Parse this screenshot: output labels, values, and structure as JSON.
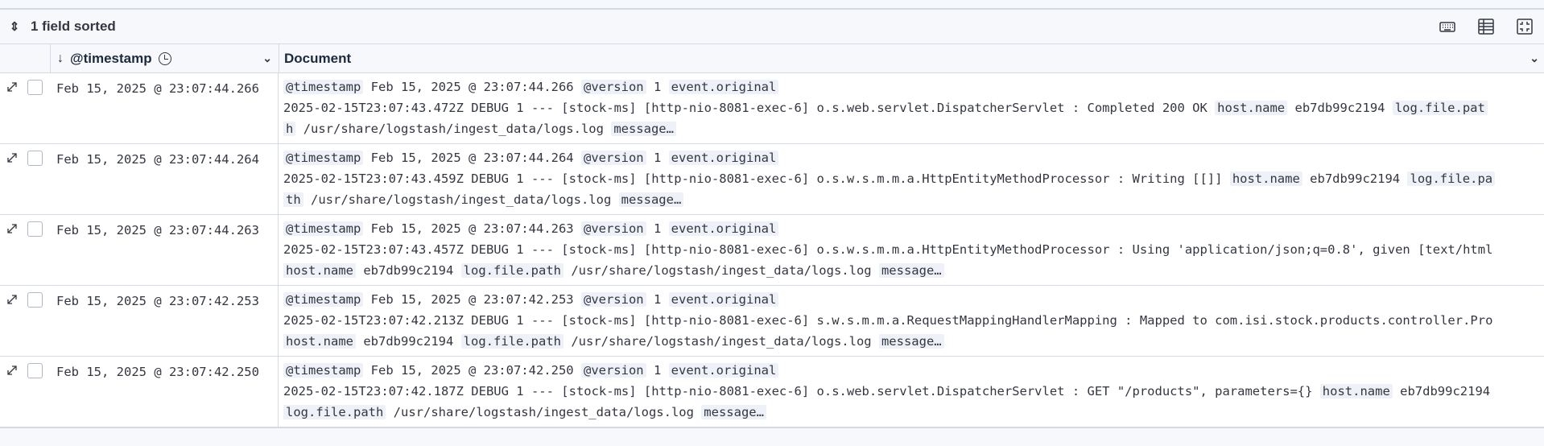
{
  "toolbar": {
    "sort_label": "1 field sorted",
    "icons": [
      "keyboard-icon",
      "density-table-icon",
      "fullscreen-icon"
    ]
  },
  "columns": {
    "timestamp_label": "@timestamp",
    "document_label": "Document"
  },
  "rows": [
    {
      "timestamp": "Feb 15, 2025 @ 23:07:44.266",
      "line1_k1": "@timestamp",
      "line1_v1": "Feb 15, 2025 @ 23:07:44.266",
      "line1_k2": "@version",
      "line1_v2": "1",
      "line1_k3": "event.original",
      "line2": "2025-02-15T23:07:43.472Z DEBUG 1 --- [stock-ms] [http-nio-8081-exec-6] o.s.web.servlet.DispatcherServlet : Completed 200 OK ",
      "line2_k": "host.name",
      "line2_v": "eb7db99c2194",
      "line2_k2": "log.file.pat",
      "line3_pre": "h",
      "line3_v": "/usr/share/logstash/ingest_data/logs.log",
      "line3_k": "message…"
    },
    {
      "timestamp": "Feb 15, 2025 @ 23:07:44.264",
      "line1_k1": "@timestamp",
      "line1_v1": "Feb 15, 2025 @ 23:07:44.264",
      "line1_k2": "@version",
      "line1_v2": "1",
      "line1_k3": "event.original",
      "line2": "2025-02-15T23:07:43.459Z DEBUG 1 --- [stock-ms] [http-nio-8081-exec-6] o.s.w.s.m.m.a.HttpEntityMethodProcessor : Writing [[]] ",
      "line2_k": "host.name",
      "line2_v": "eb7db99c2194",
      "line2_k2": "log.file.pa",
      "line3_pre": "th",
      "line3_v": "/usr/share/logstash/ingest_data/logs.log",
      "line3_k": "message…"
    },
    {
      "timestamp": "Feb 15, 2025 @ 23:07:44.263",
      "line1_k1": "@timestamp",
      "line1_v1": "Feb 15, 2025 @ 23:07:44.263",
      "line1_k2": "@version",
      "line1_v2": "1",
      "line1_k3": "event.original",
      "line2": "2025-02-15T23:07:43.457Z DEBUG 1 --- [stock-ms] [http-nio-8081-exec-6] o.s.w.s.m.m.a.HttpEntityMethodProcessor : Using 'application/json;q=0.8', given [text/html",
      "line2_k": "",
      "line2_v": "",
      "line2_k2": "",
      "line3_pre": "",
      "line3_hk": "host.name",
      "line3_hv": "eb7db99c2194",
      "line3_fk": "log.file.path",
      "line3_v": "/usr/share/logstash/ingest_data/logs.log",
      "line3_k": "message…"
    },
    {
      "timestamp": "Feb 15, 2025 @ 23:07:42.253",
      "line1_k1": "@timestamp",
      "line1_v1": "Feb 15, 2025 @ 23:07:42.253",
      "line1_k2": "@version",
      "line1_v2": "1",
      "line1_k3": "event.original",
      "line2": "2025-02-15T23:07:42.213Z DEBUG 1 --- [stock-ms] [http-nio-8081-exec-6] s.w.s.m.m.a.RequestMappingHandlerMapping : Mapped to com.isi.stock.products.controller.Pro",
      "line2_k": "",
      "line2_v": "",
      "line2_k2": "",
      "line3_pre": "",
      "line3_hk": "host.name",
      "line3_hv": "eb7db99c2194",
      "line3_fk": "log.file.path",
      "line3_v": "/usr/share/logstash/ingest_data/logs.log",
      "line3_k": "message…"
    },
    {
      "timestamp": "Feb 15, 2025 @ 23:07:42.250",
      "line1_k1": "@timestamp",
      "line1_v1": "Feb 15, 2025 @ 23:07:42.250",
      "line1_k2": "@version",
      "line1_v2": "1",
      "line1_k3": "event.original",
      "line2": "2025-02-15T23:07:42.187Z DEBUG 1 --- [stock-ms] [http-nio-8081-exec-6] o.s.web.servlet.DispatcherServlet : GET \"/products\", parameters={} ",
      "line2_k": "host.name",
      "line2_v": "eb7db99c2194",
      "line2_k2": "",
      "line3_pre": "",
      "line3_fk": "log.file.path",
      "line3_v": "/usr/share/logstash/ingest_data/logs.log",
      "line3_k": "message…"
    }
  ]
}
